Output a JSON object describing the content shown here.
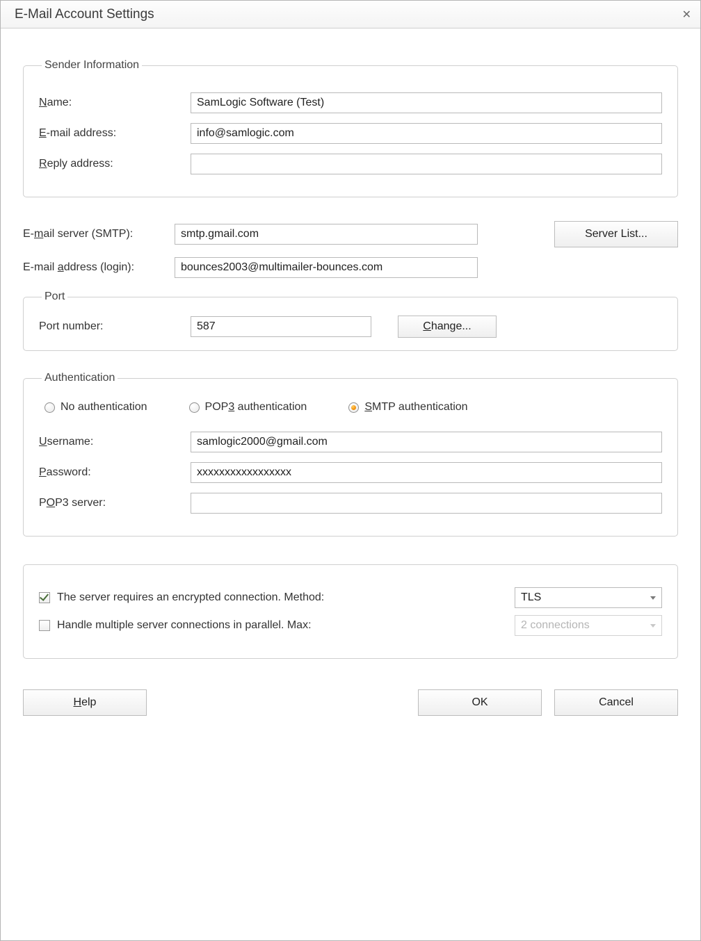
{
  "window": {
    "title": "E-Mail Account Settings"
  },
  "sender": {
    "legend": "Sender Information",
    "name_label_pre": "N",
    "name_label_post": "ame:",
    "name_value": "SamLogic Software (Test)",
    "email_label_pre": "E",
    "email_label_post": "-mail address:",
    "email_value": "info@samlogic.com",
    "reply_label_pre": "R",
    "reply_label_post": "eply address:",
    "reply_value": ""
  },
  "server": {
    "smtp_label_pre": "E-",
    "smtp_label_u": "m",
    "smtp_label_post": "ail server (SMTP):",
    "smtp_value": "smtp.gmail.com",
    "server_list_button": "Server List...",
    "login_label_pre": "E-mail ",
    "login_label_u": "a",
    "login_label_post": "ddress (login):",
    "login_value": "bounces2003@multimailer-bounces.com"
  },
  "port": {
    "legend": "Port",
    "label": "Port number:",
    "value": "587",
    "change_u": "C",
    "change_post": "hange..."
  },
  "auth": {
    "legend": "Authentication",
    "radio_none": "No authentication",
    "radio_pop3_pre": "POP",
    "radio_pop3_u": "3",
    "radio_pop3_post": " authentication",
    "radio_smtp_u": "S",
    "radio_smtp_post": "MTP authentication",
    "selected": "smtp",
    "username_label_pre": "U",
    "username_label_post": "sername:",
    "username_value": "samlogic2000@gmail.com",
    "password_label_pre": "P",
    "password_label_post": "assword:",
    "password_value": "xxxxxxxxxxxxxxxxx",
    "pop3_label_pre": "P",
    "pop3_label_u": "O",
    "pop3_label_post": "P3 server:",
    "pop3_value": ""
  },
  "encryption": {
    "cb1_label": "The server requires an encrypted connection. Method:",
    "cb1_checked": true,
    "cb1_select_value": "TLS",
    "cb2_label": "Handle multiple server connections in parallel. Max:",
    "cb2_checked": false,
    "cb2_select_value": "2 connections"
  },
  "buttons": {
    "help_u": "H",
    "help_post": "elp",
    "ok": "OK",
    "cancel": "Cancel"
  }
}
